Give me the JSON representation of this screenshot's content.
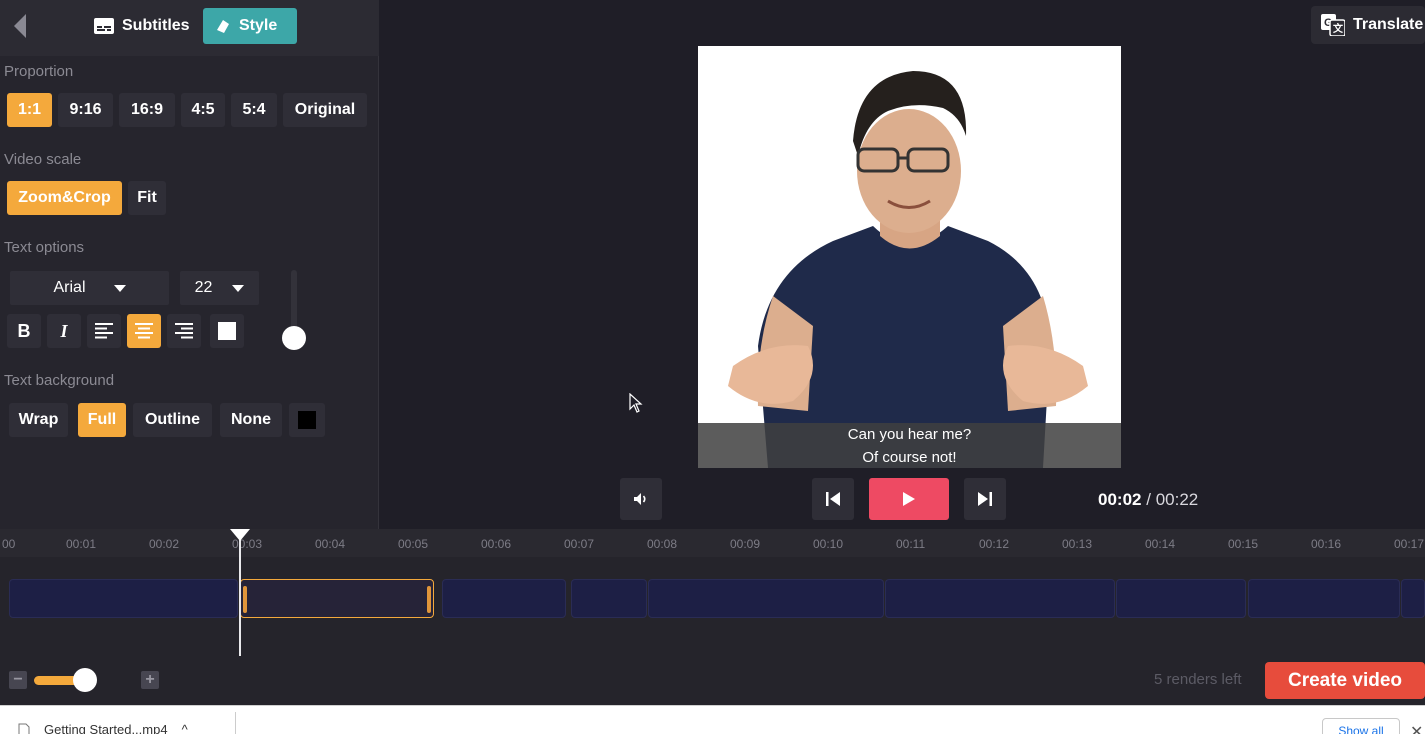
{
  "top_tabs": {
    "subtitles": "Subtitles",
    "style": "Style"
  },
  "translate": "Translate",
  "proportion": {
    "label": "Proportion",
    "options": [
      "1:1",
      "9:16",
      "16:9",
      "4:5",
      "5:4",
      "Original"
    ],
    "selected": "1:1"
  },
  "video_scale": {
    "label": "Video scale",
    "options": [
      "Zoom&Crop",
      "Fit"
    ],
    "selected": "Zoom&Crop"
  },
  "text_options": {
    "label": "Text options",
    "font": "Arial",
    "size": "22",
    "bold": "B",
    "italic": "I",
    "align_selected": "center",
    "color": "#ffffff"
  },
  "text_background": {
    "label": "Text background",
    "options": [
      "Wrap",
      "Full",
      "Outline",
      "None"
    ],
    "selected": "Full",
    "color": "#000000"
  },
  "preview": {
    "subtitle_line1": "Can you hear me?",
    "subtitle_line2": "Of course not!"
  },
  "player": {
    "current_time": "00:02",
    "separator": "/",
    "total_time": "00:22"
  },
  "timeline": {
    "ticks": [
      "00",
      "00:01",
      "00:02",
      "00:03",
      "00:04",
      "00:05",
      "00:06",
      "00:07",
      "00:08",
      "00:09",
      "00:10",
      "00:11",
      "00:12",
      "00:13",
      "00:14",
      "00:15",
      "00:16",
      "00:17"
    ]
  },
  "footer": {
    "renders_left": "5 renders left",
    "create_video": "Create video",
    "zoom_minus": "−",
    "zoom_plus": "+"
  },
  "downloads": {
    "file_name": "Getting Started...mp4",
    "chevron": "^",
    "show_all": "Show all",
    "close": "✕"
  },
  "colors": {
    "accent": "#f4a93c",
    "teal": "#3da7a8",
    "play": "#ee4a63",
    "create": "#e74c3c"
  }
}
